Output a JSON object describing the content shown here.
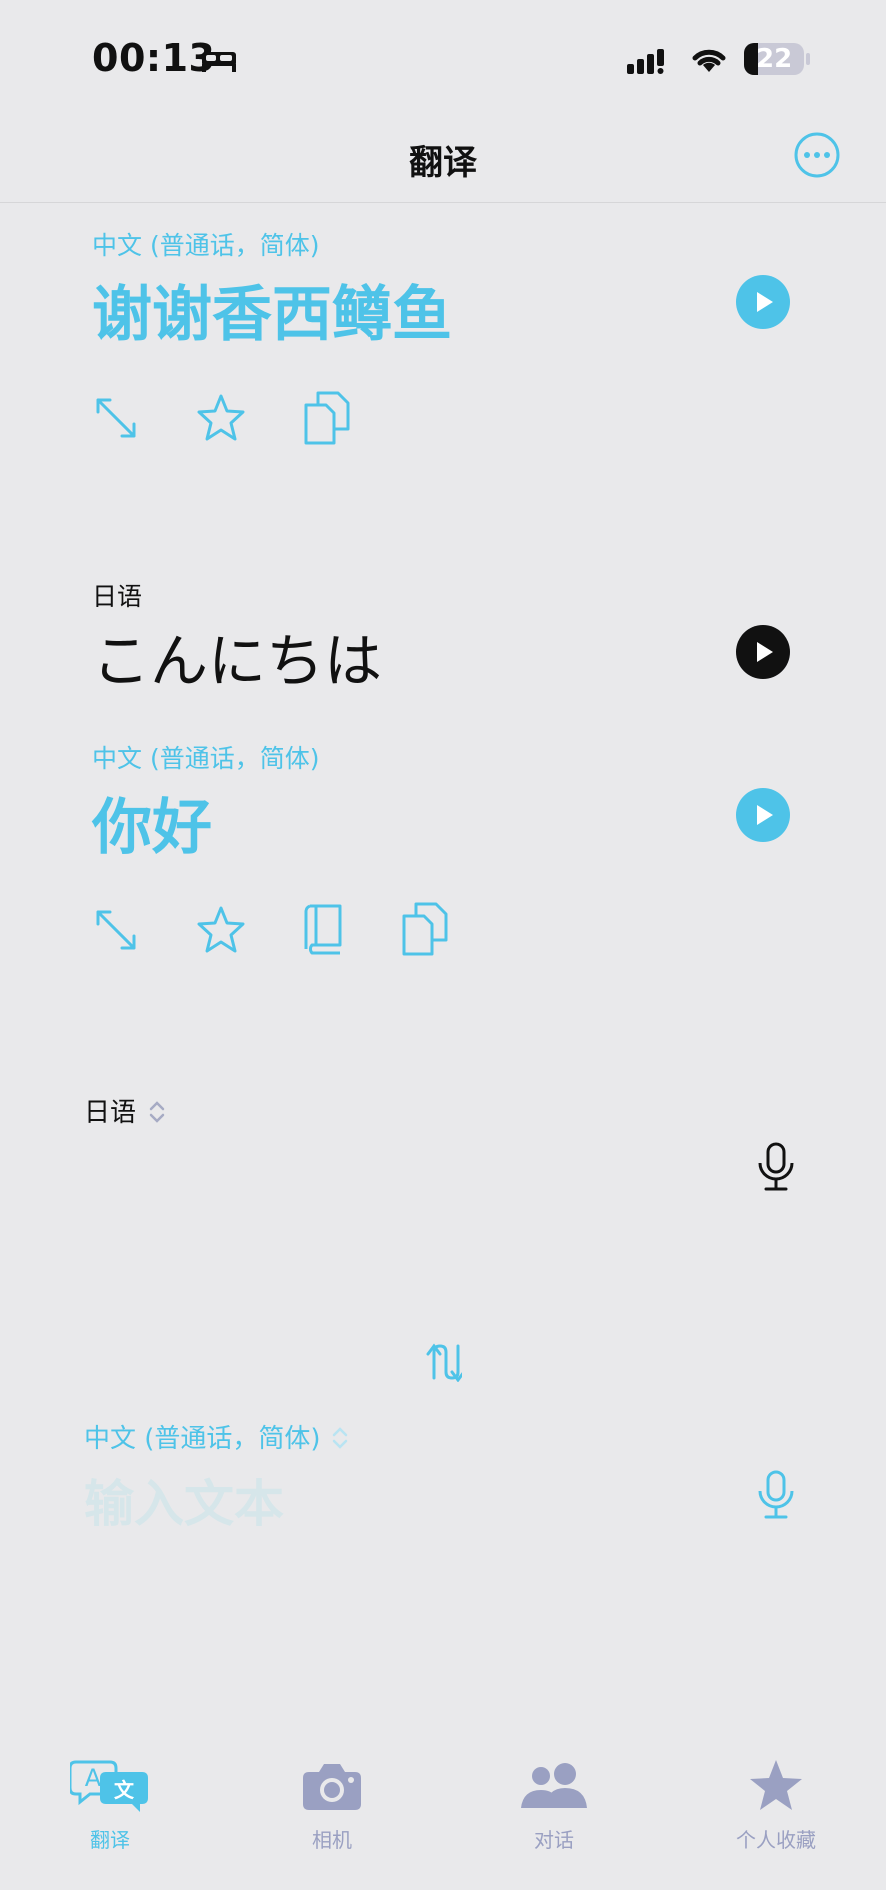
{
  "status_bar": {
    "time": "00:13",
    "battery": "22"
  },
  "header": {
    "title": "翻译"
  },
  "history": [
    {
      "translation_lang": "中文 (普通话，简体)",
      "translation_text": "谢谢香西鳟鱼"
    },
    {
      "source_lang": "日语",
      "source_text": "こんにちは",
      "translation_lang": "中文 (普通话，简体)",
      "translation_text": "你好"
    }
  ],
  "input": {
    "source_lang": "日语",
    "target_lang": "中文 (普通话，简体)",
    "placeholder": "输入文本"
  },
  "tabs": [
    {
      "label": "翻译",
      "active": true
    },
    {
      "label": "相机",
      "active": false
    },
    {
      "label": "对话",
      "active": false
    },
    {
      "label": "个人收藏",
      "active": false
    }
  ],
  "colors": {
    "accent": "#4ec3e8",
    "inactive_tab": "#9aa0c2",
    "background": "#e9e9eb"
  }
}
